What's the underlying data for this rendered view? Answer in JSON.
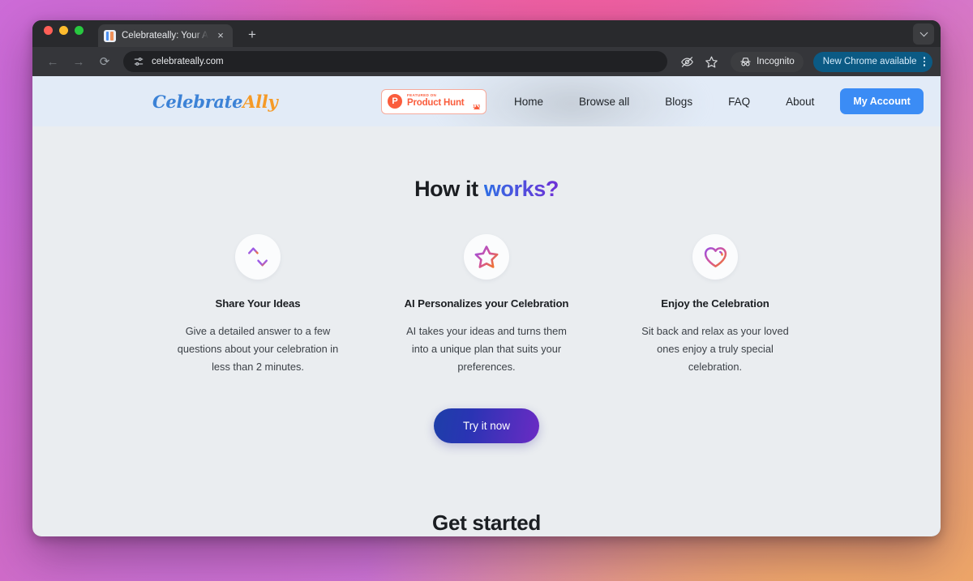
{
  "browser": {
    "tab": {
      "title": "Celebrateally: Your AI Celebra",
      "close_label": "×",
      "favicon_name": "site-favicon"
    },
    "new_tab_label": "+",
    "back_label": "←",
    "forward_label": "→",
    "reload_label": "⟳",
    "omnibox": {
      "url": "celebrateally.com",
      "site_settings_icon": "tune-icon"
    },
    "toolbar": {
      "tracking_protection_icon": "eye-slash-icon",
      "bookmark_icon": "star-icon",
      "incognito_label": "Incognito",
      "incognito_icon": "incognito-hat-icon",
      "update_label": "New Chrome available",
      "menu_icon": "kebab-menu-icon",
      "tab_search_icon": "chevron-down-icon"
    }
  },
  "site": {
    "header": {
      "logo": {
        "part1": "Celebrate",
        "part2": "Ally"
      },
      "product_hunt": {
        "featured_label": "FEATURED ON",
        "name": "Product Hunt",
        "votes": "113",
        "badge_letter": "P"
      },
      "nav": [
        {
          "label": "Home"
        },
        {
          "label": "Browse all"
        },
        {
          "label": "Blogs"
        },
        {
          "label": "FAQ"
        },
        {
          "label": "About"
        }
      ],
      "account_button": "My Account"
    },
    "how_it_works": {
      "title_plain": "How it ",
      "title_accent": "works?",
      "cards": [
        {
          "icon": "arrows-up-down-icon",
          "title": "Share Your Ideas",
          "desc": "Give a detailed answer to a few questions about your celebration in less than 2 minutes."
        },
        {
          "icon": "star-outline-icon",
          "title": "AI Personalizes your Celebration",
          "desc": "AI takes your ideas and turns them into a unique plan that suits your preferences."
        },
        {
          "icon": "heart-outline-icon",
          "title": "Enjoy the Celebration",
          "desc": "Sit back and relax as your loved ones enjoy a truly special celebration."
        }
      ],
      "cta_label": "Try it now"
    },
    "get_started_heading": "Get started"
  },
  "colors": {
    "accent_blue": "#3b8cf5",
    "gradient_start": "#2f6fe4",
    "gradient_end": "#6f2fd6",
    "product_hunt_red": "#fa5c3c",
    "logo_blue": "#3c82d6",
    "logo_orange": "#f59a27",
    "header_bg": "#e2ebf7",
    "page_bg": "#eaedf0",
    "chrome_update_bg": "#0b5a84"
  }
}
